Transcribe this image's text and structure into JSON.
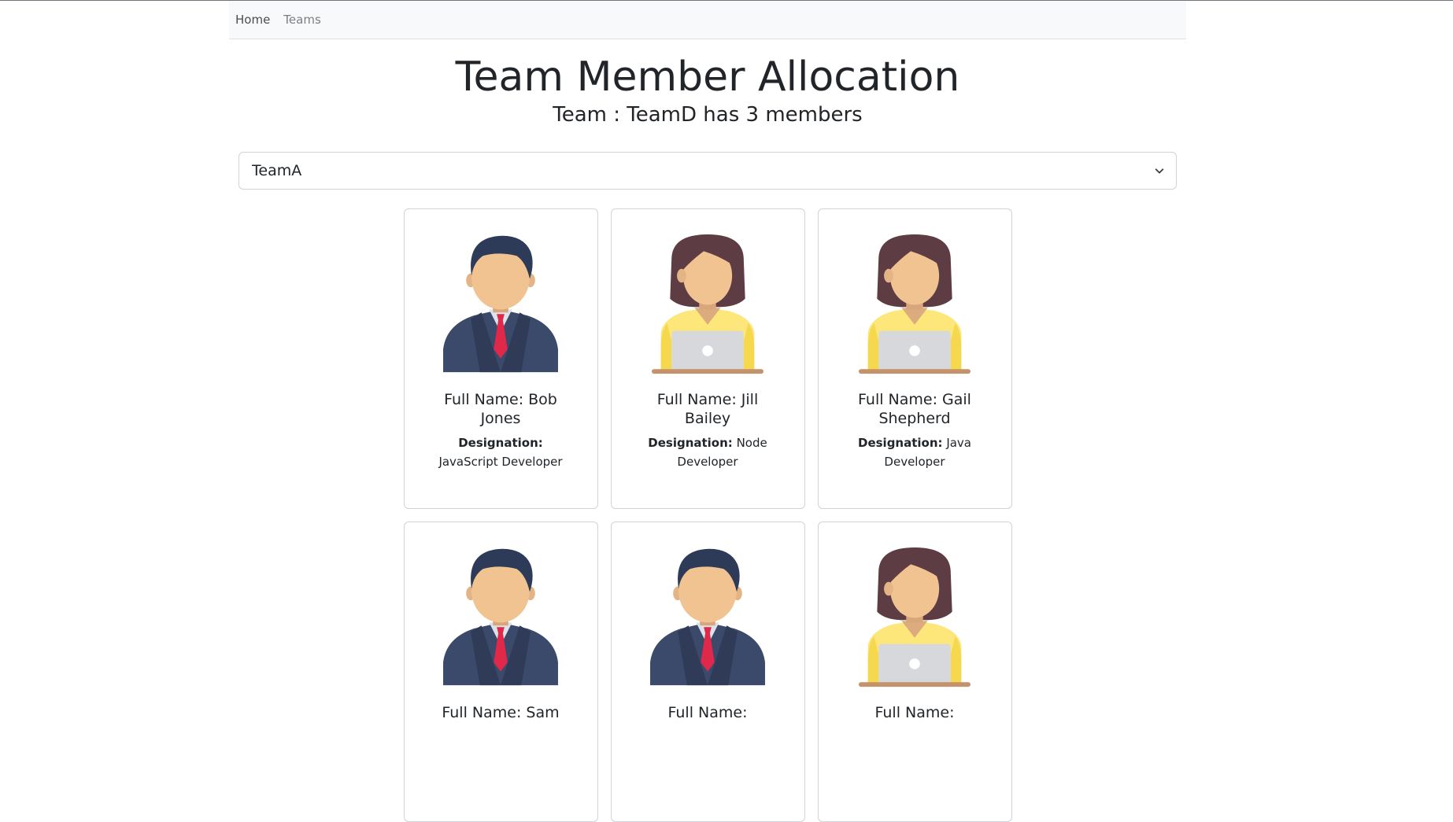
{
  "nav": {
    "home": "Home",
    "teams": "Teams"
  },
  "header": {
    "title": "Team Member Allocation",
    "subtitle": "Team : TeamD has 3 members"
  },
  "team_select": {
    "value": "TeamA"
  },
  "designation_label": "Designation:",
  "members": [
    {
      "name": "Full Name: Bob Jones",
      "designation": "JavaScript Developer",
      "avatar": "male-avatar"
    },
    {
      "name": "Full Name: Jill Bailey",
      "designation": "Node Developer",
      "avatar": "female-avatar"
    },
    {
      "name": "Full Name: Gail Shepherd",
      "designation": "Java Developer",
      "avatar": "female-avatar"
    },
    {
      "name": "Full Name: Sam",
      "designation": "",
      "avatar": "male-avatar"
    },
    {
      "name": "Full Name:",
      "designation": "",
      "avatar": "male-avatar"
    },
    {
      "name": "Full Name:",
      "designation": "",
      "avatar": "female-avatar"
    }
  ]
}
